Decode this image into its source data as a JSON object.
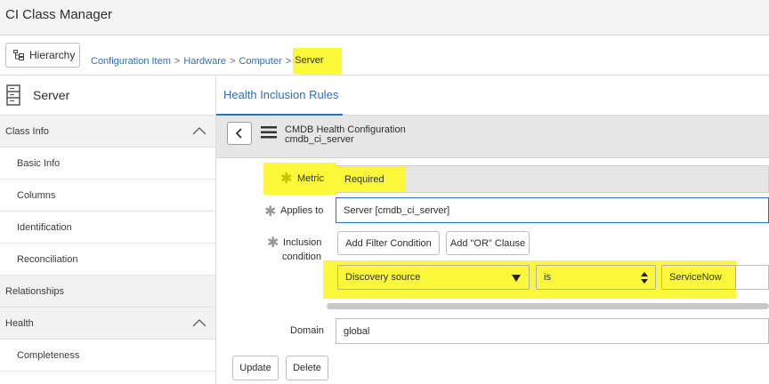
{
  "app": {
    "title": "CI Class Manager"
  },
  "toolbar": {
    "hierarchy_label": "Hierarchy"
  },
  "breadcrumb": {
    "items": [
      "Configuration Item",
      "Hardware",
      "Computer"
    ],
    "current": "Server",
    "separator": ">"
  },
  "sidebar": {
    "class_name": "Server",
    "items": [
      {
        "label": "Class Info"
      },
      {
        "label": "Basic Info"
      },
      {
        "label": "Columns"
      },
      {
        "label": "Identification"
      },
      {
        "label": "Reconciliation"
      },
      {
        "label": "Relationships"
      },
      {
        "label": "Health"
      },
      {
        "label": "Completeness"
      }
    ]
  },
  "main": {
    "tab": "Health Inclusion Rules",
    "form_title": "CMDB Health Configuration",
    "form_subtitle": "cmdb_ci_server",
    "metric": {
      "label": "Metric",
      "value": "Required"
    },
    "applies_to": {
      "label": "Applies to",
      "value": "Server [cmdb_ci_server]"
    },
    "inclusion": {
      "label_line1": "Inclusion",
      "label_line2": "condition",
      "add_filter_label": "Add Filter Condition",
      "add_or_label": "Add \"OR\" Clause",
      "field": "Discovery source",
      "operator": "is",
      "value": "ServiceNow"
    },
    "domain": {
      "label": "Domain",
      "value": "global"
    },
    "update_label": "Update",
    "delete_label": "Delete"
  },
  "colors": {
    "highlight": "#fbf83b",
    "link": "#2f6fb3"
  }
}
